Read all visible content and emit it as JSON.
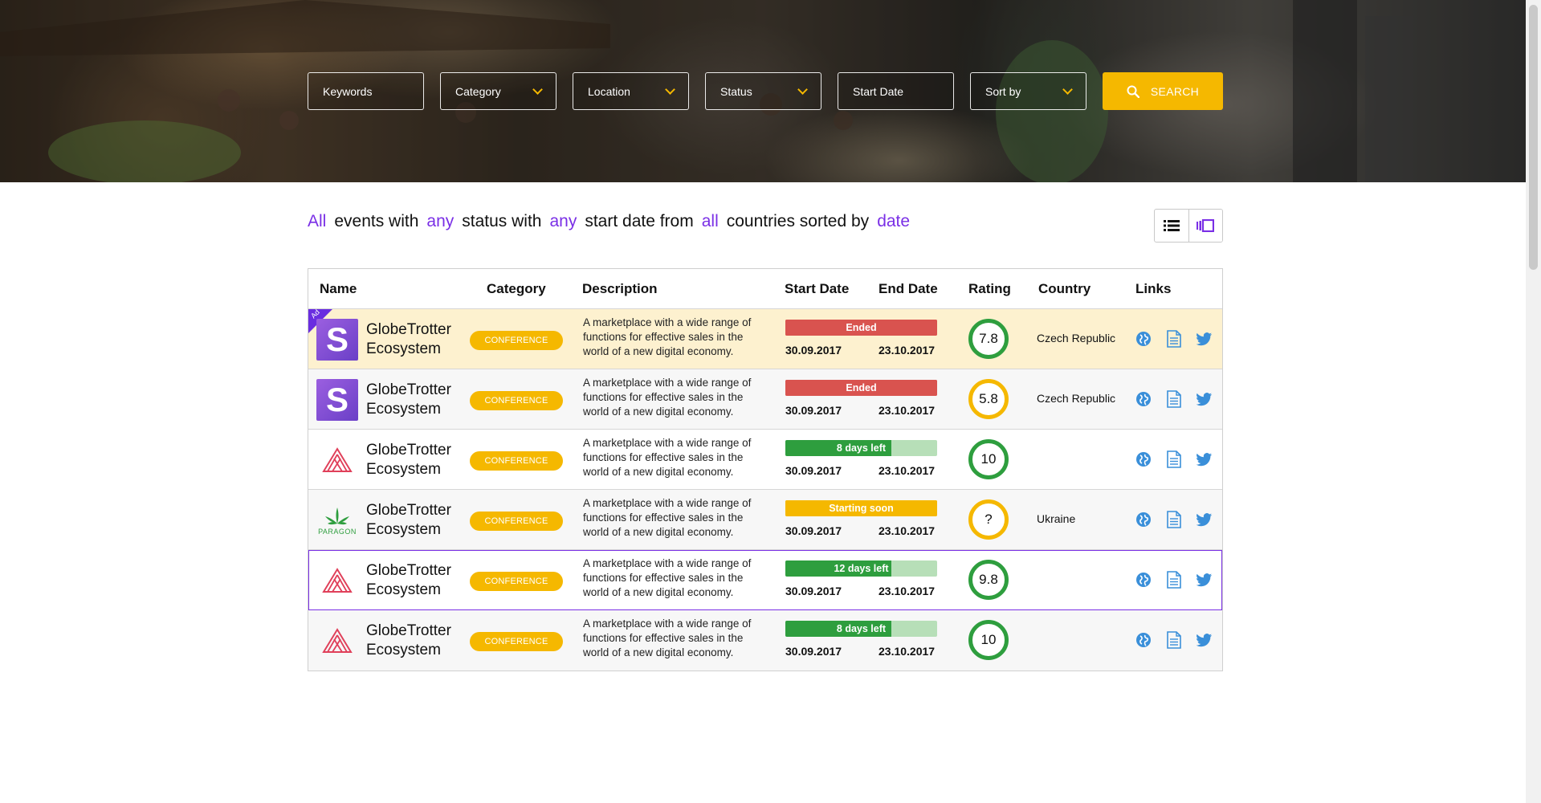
{
  "filters": {
    "keywords": "Keywords",
    "category": "Category",
    "location": "Location",
    "status": "Status",
    "start_date": "Start Date",
    "sort_by": "Sort by",
    "search_label": "SEARCH"
  },
  "summary": {
    "p1": "All",
    "t1": "events with",
    "p2": "any",
    "t2": "status with",
    "p3": "any",
    "t3": "start date from",
    "p4": "all",
    "t4": "countries sorted by",
    "p5": "date"
  },
  "table": {
    "headers": {
      "name": "Name",
      "category": "Category",
      "description": "Description",
      "start_date": "Start Date",
      "end_date": "End Date",
      "rating": "Rating",
      "country": "Country",
      "links": "Links"
    },
    "rows": [
      {
        "ad_label": "Ad",
        "logo": "s-logo",
        "logo_letter": "S",
        "name_line1": "GlobeTrotter",
        "name_line2": "Ecosystem",
        "category": "CONFERENCE",
        "description": "A marketplace with a wide range of functions for effective sales in the world of a new digital economy.",
        "status": "Ended",
        "status_color": "#d9534f",
        "status_progress": 1.0,
        "start": "30.09.2017",
        "end": "23.10.2017",
        "rating": "7.8",
        "rating_color": "#2e9e3e",
        "country": "Czech Republic"
      },
      {
        "logo": "s-logo",
        "logo_letter": "S",
        "name_line1": "GlobeTrotter",
        "name_line2": "Ecosystem",
        "category": "CONFERENCE",
        "description": "A marketplace with a wide range of functions for effective sales in the world of a new digital economy.",
        "status": "Ended",
        "status_color": "#d9534f",
        "status_progress": 1.0,
        "start": "30.09.2017",
        "end": "23.10.2017",
        "rating": "5.8",
        "rating_color": "#f5b800",
        "country": "Czech Republic"
      },
      {
        "logo": "triangle-logo",
        "name_line1": "GlobeTrotter",
        "name_line2": "Ecosystem",
        "category": "CONFERENCE",
        "description": "A marketplace with a wide range of functions for effective sales in the world of a new digital economy.",
        "status": "8 days left",
        "status_color": "#2e9e3e",
        "status_progress": 0.7,
        "start": "30.09.2017",
        "end": "23.10.2017",
        "rating": "10",
        "rating_color": "#2e9e3e",
        "country": ""
      },
      {
        "logo": "paragon-logo",
        "logo_text": "PARAGON",
        "name_line1": "GlobeTrotter",
        "name_line2": "Ecosystem",
        "category": "CONFERENCE",
        "description": "A marketplace with a wide range of functions for effective sales in the world of a new digital economy.",
        "status": "Starting soon",
        "status_color": "#f5b800",
        "status_progress": 1.0,
        "start": "30.09.2017",
        "end": "23.10.2017",
        "rating": "?",
        "rating_color": "#f5b800",
        "country": "Ukraine"
      },
      {
        "logo": "triangle-logo",
        "name_line1": "GlobeTrotter",
        "name_line2": "Ecosystem",
        "category": "CONFERENCE",
        "description": "A marketplace with a wide range of functions for effective sales in the world of a new digital economy.",
        "status": "12 days left",
        "status_color": "#2e9e3e",
        "status_progress": 0.7,
        "start": "30.09.2017",
        "end": "23.10.2017",
        "rating": "9.8",
        "rating_color": "#2e9e3e",
        "country": ""
      },
      {
        "logo": "triangle-logo",
        "name_line1": "GlobeTrotter",
        "name_line2": "Ecosystem",
        "category": "CONFERENCE",
        "description": "A marketplace with a wide range of functions for effective sales in the world of a new digital economy.",
        "status": "8 days left",
        "status_color": "#2e9e3e",
        "status_progress": 0.7,
        "start": "30.09.2017",
        "end": "23.10.2017",
        "rating": "10",
        "rating_color": "#2e9e3e",
        "country": ""
      }
    ]
  },
  "colors": {
    "accent": "#f5b800",
    "link_accent": "#7a2fe6",
    "ended": "#d9534f",
    "active": "#2e9e3e",
    "remaining": "#b7dfb8",
    "icon_blue": "#3a8fd9"
  },
  "icons": {
    "search": "search-icon",
    "list_view": "list-view-icon",
    "card_view": "card-view-icon",
    "website": "globe-icon",
    "whitepaper": "document-icon",
    "twitter": "twitter-icon"
  }
}
